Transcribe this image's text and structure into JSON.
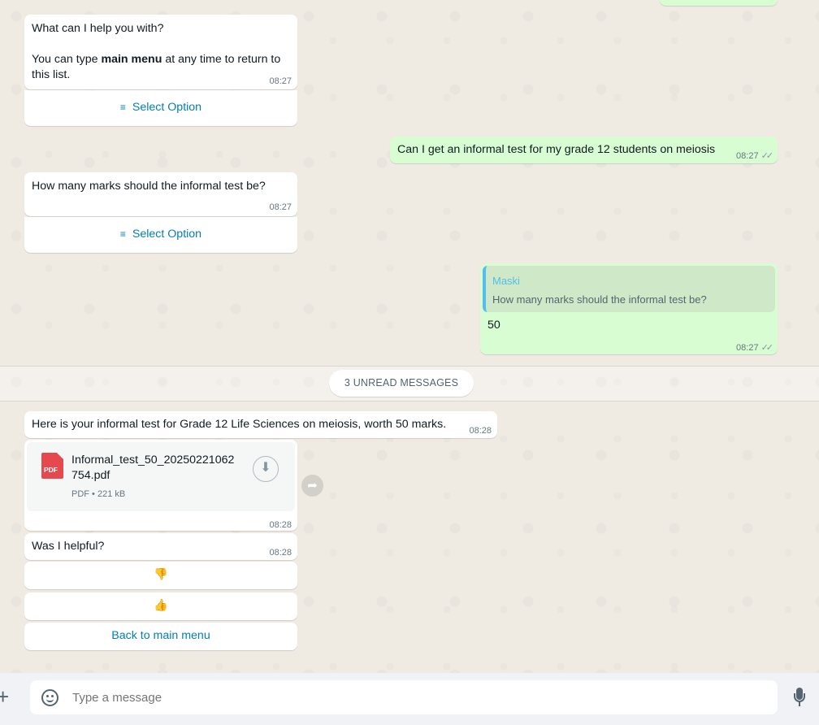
{
  "messages": {
    "m1": {
      "line1": "What can I help you with?",
      "line2_prefix": "You can type ",
      "line2_bold": "main menu",
      "line2_suffix": " at any time to return to",
      "line3": "this list.",
      "time": "08:27",
      "button": "Select Option"
    },
    "m2": {
      "text": "Can I get an informal test for my grade 12 students on meiosis",
      "time": "08:27"
    },
    "m3": {
      "text": "How many marks should the informal test be?",
      "time": "08:27",
      "button": "Select Option"
    },
    "m4": {
      "quote_author": "Maski",
      "quote_text": "How many marks should the informal test be?",
      "text": "50",
      "time": "08:27"
    },
    "unread": "3 UNREAD MESSAGES",
    "m5": {
      "text": "Here is your informal test for Grade 12 Life Sciences on meiosis, worth 50 marks.",
      "time": "08:28"
    },
    "m6": {
      "file_line1": "Informal_test_50_20250221062",
      "file_line2": "754.pdf",
      "file_type": "PDF",
      "file_size": "221 kB",
      "pdf_badge": "PDF",
      "time": "08:28"
    },
    "m7": {
      "text": "Was I helpful?",
      "time": "08:28",
      "thumbs_down": "👎",
      "thumbs_up": "👍",
      "back": "Back to main menu"
    }
  },
  "composer": {
    "placeholder": "Type a message"
  },
  "icons": {
    "list": "list-icon",
    "double_check": "double-check-icon",
    "download": "download-icon",
    "forward": "forward-icon",
    "plus": "plus-icon",
    "sticker": "sticker-icon",
    "mic": "mic-icon"
  },
  "colors": {
    "incoming": "#ffffff",
    "outgoing": "#d9fdd3",
    "link": "#027eb5",
    "quote_bar": "#53bdeb",
    "pdf": "#e5484d"
  }
}
